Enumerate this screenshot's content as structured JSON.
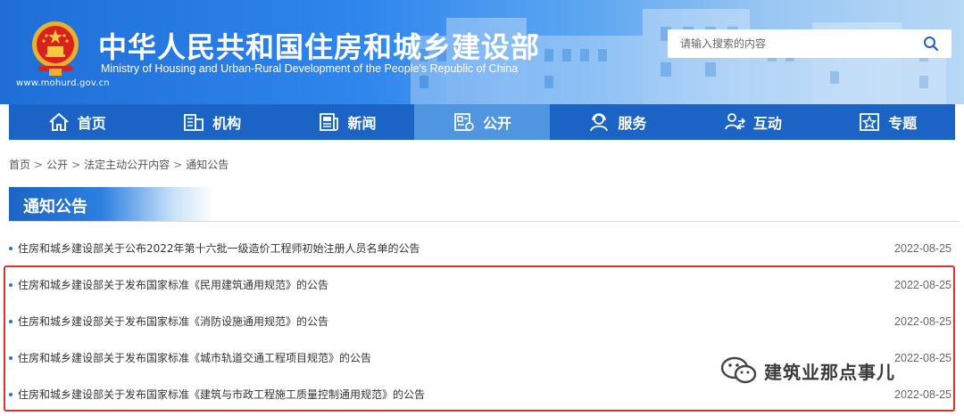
{
  "header": {
    "site_url": "www.mohurd.gov.cn",
    "title_cn": "中华人民共和国住房和城乡建设部",
    "title_en": "Ministry of Housing and Urban-Rural Development of the People's Republic of China",
    "search_placeholder": "请输入搜索的内容"
  },
  "nav": {
    "items": [
      {
        "label": "首页",
        "icon": "home-icon"
      },
      {
        "label": "机构",
        "icon": "building-icon"
      },
      {
        "label": "新闻",
        "icon": "news-icon"
      },
      {
        "label": "公开",
        "icon": "document-icon",
        "active": true
      },
      {
        "label": "服务",
        "icon": "service-icon"
      },
      {
        "label": "互动",
        "icon": "interaction-icon"
      },
      {
        "label": "专题",
        "icon": "star-icon"
      }
    ]
  },
  "breadcrumb": [
    "首页",
    "公开",
    "法定主动公开内容",
    "通知公告"
  ],
  "section": {
    "title": "通知公告"
  },
  "list": [
    {
      "title": "住房和城乡建设部关于公布2022年第十六批一级造价工程师初始注册人员名单的公告",
      "date": "2022-08-25"
    },
    {
      "title": "住房和城乡建设部关于发布国家标准《民用建筑通用规范》的公告",
      "date": "2022-08-25"
    },
    {
      "title": "住房和城乡建设部关于发布国家标准《消防设施通用规范》的公告",
      "date": "2022-08-25"
    },
    {
      "title": "住房和城乡建设部关于发布国家标准《城市轨道交通工程项目规范》的公告",
      "date": "2022-08-25"
    },
    {
      "title": "住房和城乡建设部关于发布国家标准《建筑与市政工程施工质量控制通用规范》的公告",
      "date": "2022-08-25"
    }
  ],
  "watermark": {
    "text": "建筑业那点事儿"
  },
  "colors": {
    "nav_bg": "#1b64c6",
    "nav_active": "#4f95e0",
    "highlight": "#e2312b",
    "bullet": "#2b6fd0"
  }
}
